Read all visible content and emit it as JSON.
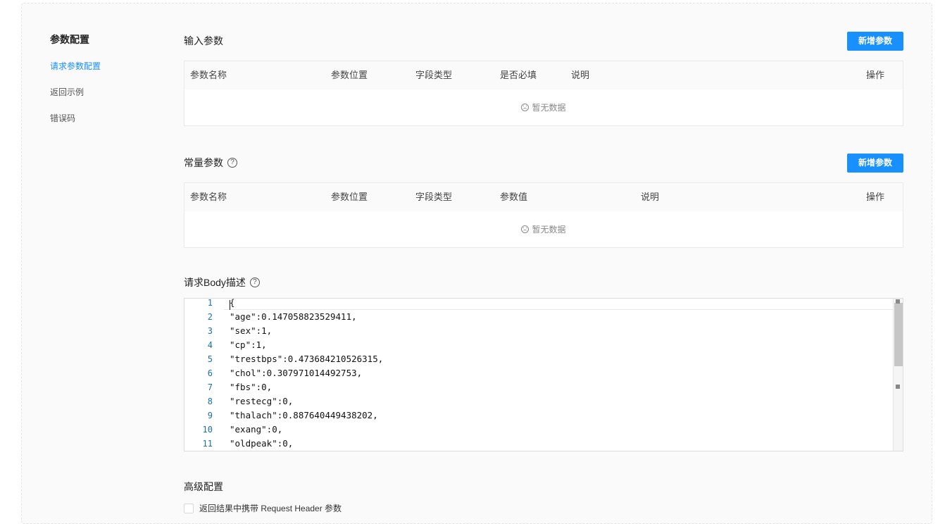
{
  "nav": {
    "title": "参数配置",
    "items": [
      {
        "label": "请求参数配置",
        "active": true
      },
      {
        "label": "返回示例",
        "active": false
      },
      {
        "label": "错误码",
        "active": false
      }
    ]
  },
  "input_params": {
    "title": "输入参数",
    "add_button": "新增参数",
    "columns": [
      "参数名称",
      "参数位置",
      "字段类型",
      "是否必填",
      "说明",
      "操作"
    ],
    "empty_text": "暂无数据"
  },
  "const_params": {
    "title": "常量参数",
    "help_icon": "question-circle-icon",
    "add_button": "新增参数",
    "columns": [
      "参数名称",
      "参数位置",
      "字段类型",
      "参数值",
      "说明",
      "操作"
    ],
    "empty_text": "暂无数据"
  },
  "body_desc": {
    "title": "请求Body描述",
    "help_icon": "question-circle-icon",
    "lines": [
      {
        "no": "1",
        "code": "{"
      },
      {
        "no": "2",
        "code": "\"age\":0.147058823529411,"
      },
      {
        "no": "3",
        "code": "\"sex\":1,"
      },
      {
        "no": "4",
        "code": "\"cp\":1,"
      },
      {
        "no": "5",
        "code": "\"trestbps\":0.473684210526315,"
      },
      {
        "no": "6",
        "code": "\"chol\":0.307971014492753,"
      },
      {
        "no": "7",
        "code": "\"fbs\":0,"
      },
      {
        "no": "8",
        "code": "\"restecg\":0,"
      },
      {
        "no": "9",
        "code": "\"thalach\":0.887640449438202,"
      },
      {
        "no": "10",
        "code": "\"exang\":0,"
      },
      {
        "no": "11",
        "code": "\"oldpeak\":0,"
      }
    ]
  },
  "advanced": {
    "title": "高级配置",
    "checkbox_label": "返回结果中携带 Request Header 参数",
    "checked": false
  },
  "colors": {
    "primary": "#1890ff",
    "line_number": "#1a6fb4"
  }
}
